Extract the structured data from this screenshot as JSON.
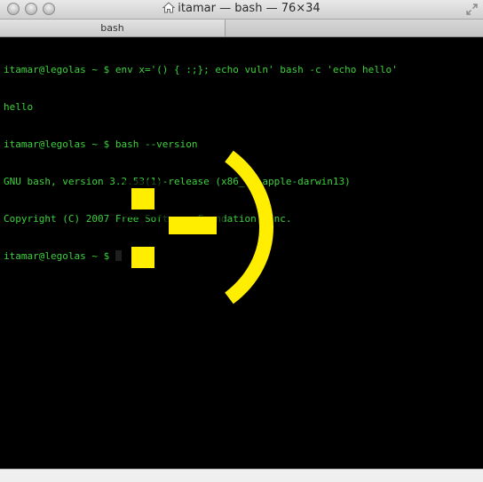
{
  "window": {
    "title": "itamar — bash — 76×34"
  },
  "tabs": [
    {
      "label": "bash"
    }
  ],
  "terminal": {
    "lines": [
      "itamar@legolas ~ $ env x='() { :;}; echo vuln' bash -c 'echo hello'",
      "hello",
      "itamar@legolas ~ $ bash --version",
      "GNU bash, version 3.2.53(1)-release (x86_64-apple-darwin13)",
      "Copyright (C) 2007 Free Software Foundation, Inc.",
      "itamar@legolas ~ $ "
    ],
    "text_color": "#3bd13b",
    "background_color": "#000000"
  },
  "smiley": {
    "text": ":-)",
    "color": "#ffee00",
    "shadow_color": "#000000"
  },
  "icons": {
    "title": "home-icon",
    "fullscreen": "fullscreen-arrows-icon",
    "close": "close-button-icon",
    "minimize": "minimize-button-icon",
    "zoom": "zoom-button-icon"
  }
}
